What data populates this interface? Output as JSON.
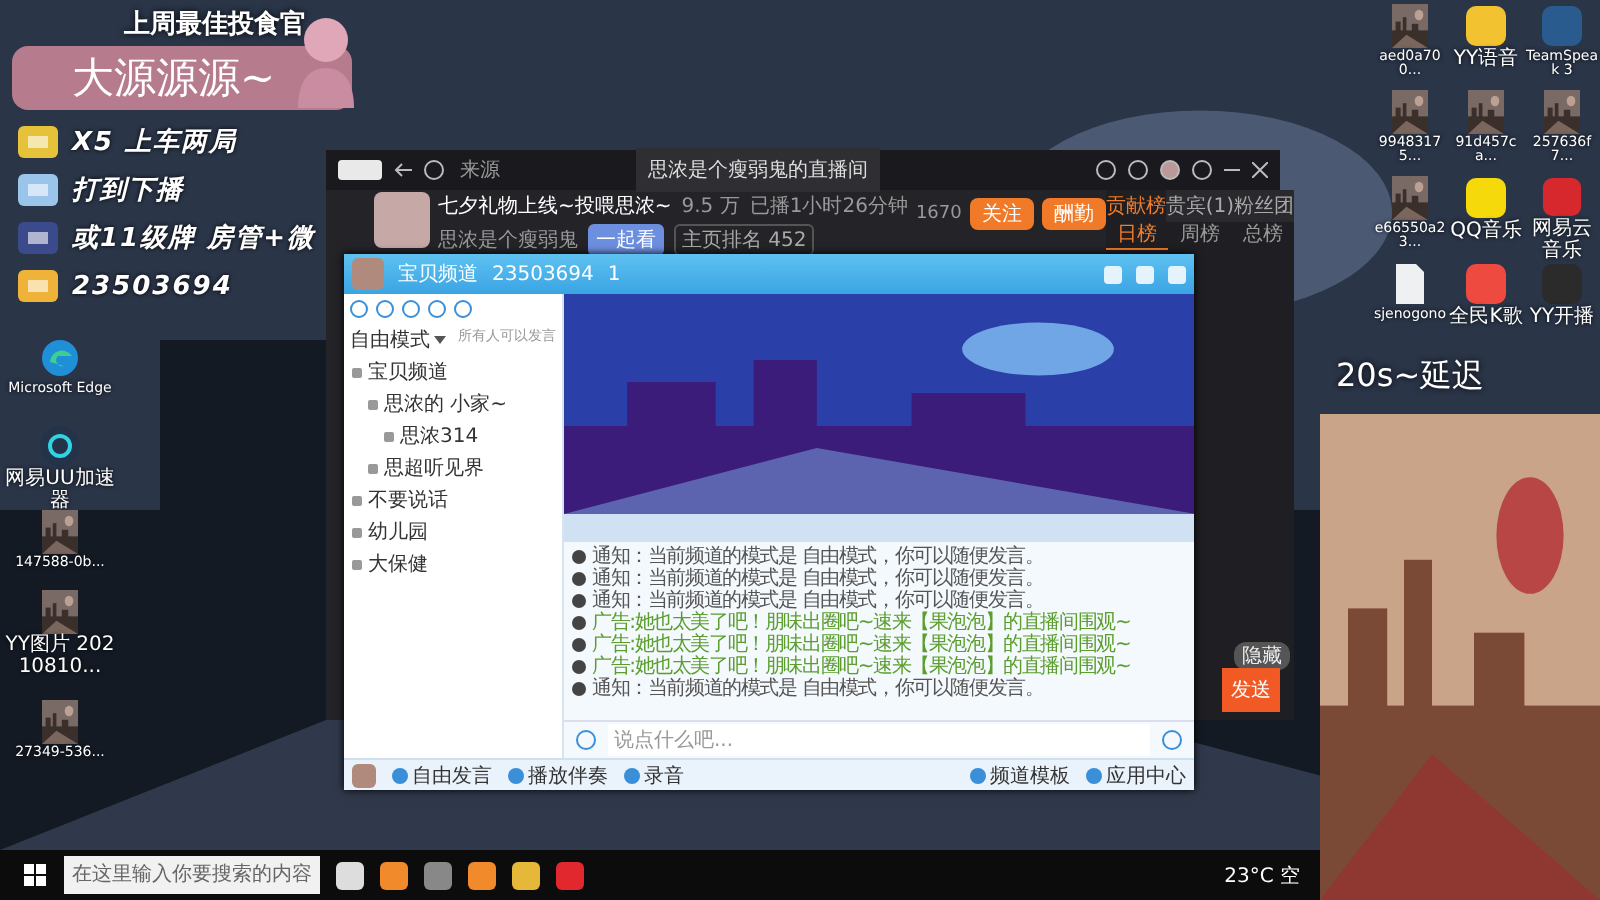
{
  "overlay": {
    "heading": "上周最佳投食官",
    "name": "大源源源~",
    "lines": [
      {
        "text": "X5  上车两局"
      },
      {
        "text": "打到下播"
      },
      {
        "text": "或11级牌  房管+微"
      },
      {
        "text": "23503694"
      }
    ]
  },
  "delay_note": "20s~延迟",
  "desktop_left": [
    {
      "label": "Microsoft Edge",
      "kind": "edge"
    },
    {
      "label": "网易UU加速器",
      "kind": "uu"
    },
    {
      "label": "147588-0b..."
    },
    {
      "label": "YY图片 20210810..."
    },
    {
      "label": "27349-536..."
    }
  ],
  "desktop_right": [
    {
      "label": "aed0a700..."
    },
    {
      "label": "YY语音",
      "kind": "yy"
    },
    {
      "label": "TeamSpeak 3",
      "kind": "teamspeak"
    },
    {
      "label": "99483175..."
    },
    {
      "label": "91d457ca..."
    },
    {
      "label": "257636f7..."
    },
    {
      "label": "e66550a23..."
    },
    {
      "label": "QQ音乐",
      "kind": "qqmusic"
    },
    {
      "label": "网易云音乐",
      "kind": "netease"
    },
    {
      "label": "sjenogono",
      "kind": "doc"
    },
    {
      "label": "全民K歌",
      "kind": "kge"
    },
    {
      "label": "YY开播",
      "kind": "yylive"
    }
  ],
  "stream_window": {
    "search_placeholder": "来源",
    "tab_title": "思浓是个瘦弱鬼的直播间",
    "room_title": "七夕礼物上线~投喂思浓~",
    "heat": "9.5 万",
    "duration": "已播1小时26分钟",
    "anchor": "思浓是个瘦弱鬼",
    "tags": [
      "一起看",
      "主页排名 452"
    ],
    "count": "1670",
    "buttons": [
      "关注",
      "酬勤"
    ],
    "rank_tabs": [
      {
        "label": "贡献榜",
        "selected": true
      },
      {
        "label": "贵宾(1)",
        "selected": false
      },
      {
        "label": "粉丝团",
        "selected": false
      }
    ],
    "period_tabs": [
      {
        "label": "日榜",
        "selected": true
      },
      {
        "label": "周榜",
        "selected": false
      },
      {
        "label": "总榜",
        "selected": false
      }
    ],
    "hide_label": "隐藏",
    "send_button": "发送"
  },
  "yy_window": {
    "channel": "宝贝频道",
    "channel_id": "23503694",
    "online": "1",
    "mode": "自由模式",
    "mode_hint": "所有人可以发言",
    "tree": [
      {
        "label": "宝贝频道",
        "children": [
          {
            "label": "思浓的 小家~",
            "children": [
              {
                "label": "思浓314"
              }
            ]
          },
          {
            "label": "思超听见界"
          }
        ]
      },
      {
        "label": "不要说话"
      },
      {
        "label": "幼儿园"
      },
      {
        "label": "大保健"
      }
    ],
    "messages": [
      {
        "kind": "notice",
        "text": "通知：当前频道的模式是 自由模式，你可以随便发言。"
      },
      {
        "kind": "notice",
        "text": "通知：当前频道的模式是 自由模式，你可以随便发言。"
      },
      {
        "kind": "notice",
        "text": "通知：当前频道的模式是 自由模式，你可以随便发言。"
      },
      {
        "kind": "ad",
        "text": "广告:她也太美了吧！朋味出圈吧~速来【果泡泡】的直播间围观~"
      },
      {
        "kind": "ad",
        "text": "广告:她也太美了吧！朋味出圈吧~速来【果泡泡】的直播间围观~"
      },
      {
        "kind": "ad",
        "text": "广告:她也太美了吧！朋味出圈吧~速来【果泡泡】的直播间围观~"
      },
      {
        "kind": "notice",
        "text": "通知：当前频道的模式是 自由模式，你可以随便发言。"
      }
    ],
    "input_placeholder": "说点什么吧...",
    "toolbar_left": [
      "自由发言",
      "播放伴奏",
      "录音"
    ],
    "toolbar_right": [
      "频道模板",
      "应用中心"
    ]
  },
  "taskbar": {
    "search_placeholder": "在这里输入你要搜索的内容",
    "weather": "23°C 空"
  }
}
